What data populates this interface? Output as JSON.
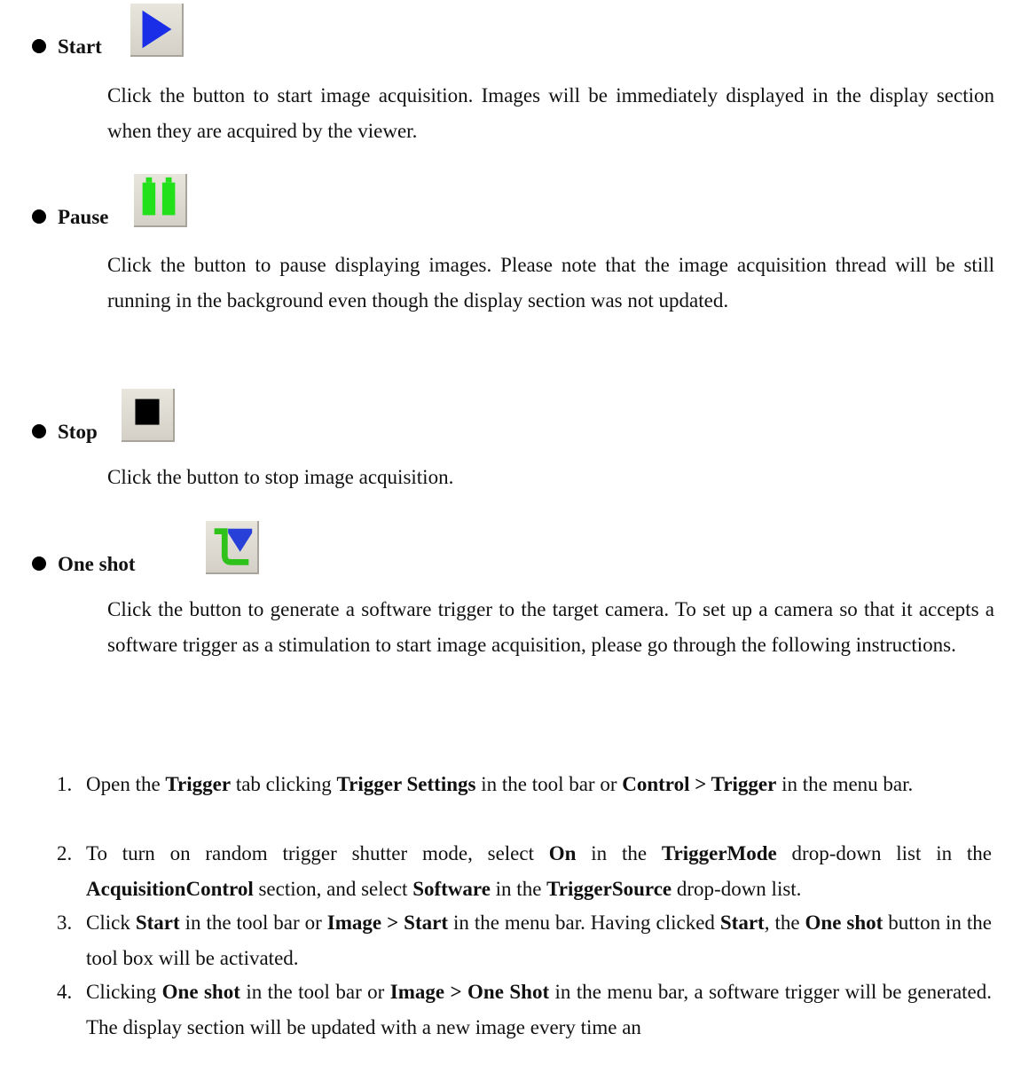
{
  "items": [
    {
      "title": "Start",
      "icon": "play-icon",
      "description": "Click the button to start image acquisition. Images will be immediately displayed in the display section when they are acquired by the viewer."
    },
    {
      "title": "Pause",
      "icon": "pause-icon",
      "description": "Click the button to pause displaying images. Please note that the image acquisition thread will be still running in the background even though the display section was not updated."
    },
    {
      "title": "Stop",
      "icon": "stop-icon",
      "description": "Click the button to stop image acquisition."
    },
    {
      "title": "One shot",
      "icon": "one-shot-icon",
      "description": "Click the button to generate a software trigger to the target camera. To set up a camera so that it accepts a software trigger as a stimulation to start image acquisition, please go through the following instructions."
    }
  ],
  "steps": [
    {
      "num": "1.",
      "parts": [
        "Open the ",
        "Trigger",
        " tab clicking ",
        "Trigger Settings",
        " in the tool bar or ",
        "Control > Trigger",
        " in the menu bar."
      ]
    },
    {
      "num": "2.",
      "parts": [
        "To turn on random trigger shutter mode, select ",
        "On",
        " in the ",
        "TriggerMode",
        " drop-down list in the ",
        "AcquisitionControl",
        " section, and select ",
        "Software",
        " in the ",
        "TriggerSource",
        " drop-down list."
      ]
    },
    {
      "num": "3.",
      "parts": [
        "Click ",
        "Start",
        " in the tool bar or ",
        "Image > Start",
        " in the menu bar. Having clicked ",
        "Start",
        ", the ",
        "One shot",
        " button in the tool box will be activated."
      ]
    },
    {
      "num": "4.",
      "parts": [
        "Clicking ",
        "One shot",
        " in the tool bar or ",
        "Image > One Shot",
        " in the menu bar, a software trigger will be generated. The display section will be updated with a new image every time an"
      ]
    }
  ],
  "colors": {
    "play": "#1a2ee8",
    "pause": "#22e01a",
    "stop": "#000000",
    "one_shot_green": "#2ec21a",
    "one_shot_blue": "#2740d8"
  }
}
